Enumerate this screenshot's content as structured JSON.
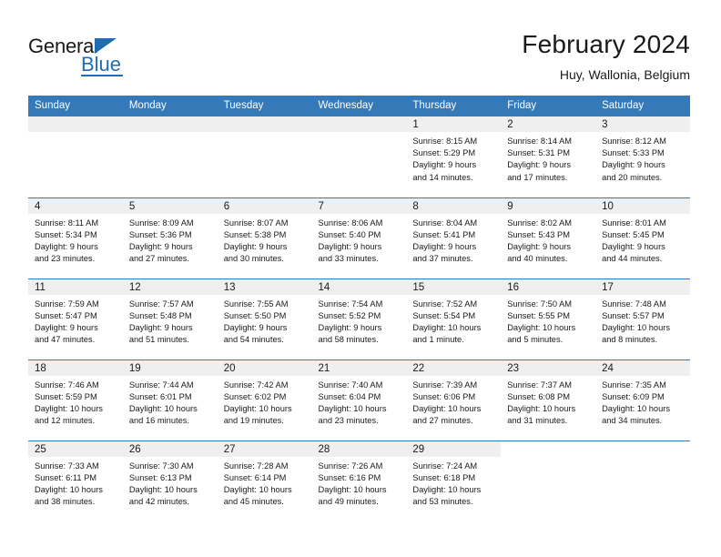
{
  "brand": {
    "name_top": "General",
    "name_bottom": "Blue",
    "accent_color": "#1f6cb4",
    "triangle_icon": "brand-triangle-icon"
  },
  "header": {
    "title": "February 2024",
    "subtitle": "Huy, Wallonia, Belgium"
  },
  "theme": {
    "header_blue": "#3579b9",
    "daynum_band": "#efefef",
    "text": "#1a1a1a",
    "page_background": "#ffffff"
  },
  "calendar": {
    "weekday_headers": [
      "Sunday",
      "Monday",
      "Tuesday",
      "Wednesday",
      "Thursday",
      "Friday",
      "Saturday"
    ],
    "weeks": [
      [
        {
          "day": "",
          "details": "",
          "empty": true
        },
        {
          "day": "",
          "details": "",
          "empty": true
        },
        {
          "day": "",
          "details": "",
          "empty": true
        },
        {
          "day": "",
          "details": "",
          "empty": true
        },
        {
          "day": "1",
          "details": "Sunrise: 8:15 AM\nSunset: 5:29 PM\nDaylight: 9 hours\nand 14 minutes."
        },
        {
          "day": "2",
          "details": "Sunrise: 8:14 AM\nSunset: 5:31 PM\nDaylight: 9 hours\nand 17 minutes."
        },
        {
          "day": "3",
          "details": "Sunrise: 8:12 AM\nSunset: 5:33 PM\nDaylight: 9 hours\nand 20 minutes."
        }
      ],
      [
        {
          "day": "4",
          "details": "Sunrise: 8:11 AM\nSunset: 5:34 PM\nDaylight: 9 hours\nand 23 minutes."
        },
        {
          "day": "5",
          "details": "Sunrise: 8:09 AM\nSunset: 5:36 PM\nDaylight: 9 hours\nand 27 minutes."
        },
        {
          "day": "6",
          "details": "Sunrise: 8:07 AM\nSunset: 5:38 PM\nDaylight: 9 hours\nand 30 minutes."
        },
        {
          "day": "7",
          "details": "Sunrise: 8:06 AM\nSunset: 5:40 PM\nDaylight: 9 hours\nand 33 minutes."
        },
        {
          "day": "8",
          "details": "Sunrise: 8:04 AM\nSunset: 5:41 PM\nDaylight: 9 hours\nand 37 minutes."
        },
        {
          "day": "9",
          "details": "Sunrise: 8:02 AM\nSunset: 5:43 PM\nDaylight: 9 hours\nand 40 minutes."
        },
        {
          "day": "10",
          "details": "Sunrise: 8:01 AM\nSunset: 5:45 PM\nDaylight: 9 hours\nand 44 minutes."
        }
      ],
      [
        {
          "day": "11",
          "details": "Sunrise: 7:59 AM\nSunset: 5:47 PM\nDaylight: 9 hours\nand 47 minutes."
        },
        {
          "day": "12",
          "details": "Sunrise: 7:57 AM\nSunset: 5:48 PM\nDaylight: 9 hours\nand 51 minutes."
        },
        {
          "day": "13",
          "details": "Sunrise: 7:55 AM\nSunset: 5:50 PM\nDaylight: 9 hours\nand 54 minutes."
        },
        {
          "day": "14",
          "details": "Sunrise: 7:54 AM\nSunset: 5:52 PM\nDaylight: 9 hours\nand 58 minutes."
        },
        {
          "day": "15",
          "details": "Sunrise: 7:52 AM\nSunset: 5:54 PM\nDaylight: 10 hours\nand 1 minute."
        },
        {
          "day": "16",
          "details": "Sunrise: 7:50 AM\nSunset: 5:55 PM\nDaylight: 10 hours\nand 5 minutes."
        },
        {
          "day": "17",
          "details": "Sunrise: 7:48 AM\nSunset: 5:57 PM\nDaylight: 10 hours\nand 8 minutes."
        }
      ],
      [
        {
          "day": "18",
          "details": "Sunrise: 7:46 AM\nSunset: 5:59 PM\nDaylight: 10 hours\nand 12 minutes."
        },
        {
          "day": "19",
          "details": "Sunrise: 7:44 AM\nSunset: 6:01 PM\nDaylight: 10 hours\nand 16 minutes."
        },
        {
          "day": "20",
          "details": "Sunrise: 7:42 AM\nSunset: 6:02 PM\nDaylight: 10 hours\nand 19 minutes."
        },
        {
          "day": "21",
          "details": "Sunrise: 7:40 AM\nSunset: 6:04 PM\nDaylight: 10 hours\nand 23 minutes."
        },
        {
          "day": "22",
          "details": "Sunrise: 7:39 AM\nSunset: 6:06 PM\nDaylight: 10 hours\nand 27 minutes."
        },
        {
          "day": "23",
          "details": "Sunrise: 7:37 AM\nSunset: 6:08 PM\nDaylight: 10 hours\nand 31 minutes."
        },
        {
          "day": "24",
          "details": "Sunrise: 7:35 AM\nSunset: 6:09 PM\nDaylight: 10 hours\nand 34 minutes."
        }
      ],
      [
        {
          "day": "25",
          "details": "Sunrise: 7:33 AM\nSunset: 6:11 PM\nDaylight: 10 hours\nand 38 minutes."
        },
        {
          "day": "26",
          "details": "Sunrise: 7:30 AM\nSunset: 6:13 PM\nDaylight: 10 hours\nand 42 minutes."
        },
        {
          "day": "27",
          "details": "Sunrise: 7:28 AM\nSunset: 6:14 PM\nDaylight: 10 hours\nand 45 minutes."
        },
        {
          "day": "28",
          "details": "Sunrise: 7:26 AM\nSunset: 6:16 PM\nDaylight: 10 hours\nand 49 minutes."
        },
        {
          "day": "29",
          "details": "Sunrise: 7:24 AM\nSunset: 6:18 PM\nDaylight: 10 hours\nand 53 minutes."
        },
        {
          "day": "",
          "details": "",
          "blank": true
        },
        {
          "day": "",
          "details": "",
          "blank": true
        }
      ]
    ]
  }
}
